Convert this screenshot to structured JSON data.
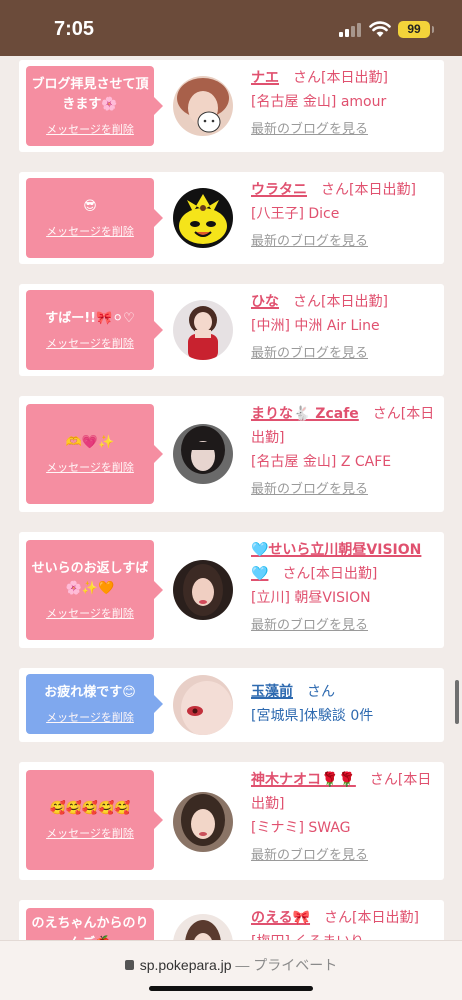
{
  "status_bar": {
    "time": "7:05",
    "battery": "99"
  },
  "browser": {
    "domain": "sp.pokepara.jp",
    "privacy": "— プライベート"
  },
  "common": {
    "delete_label": "メッセージを削除",
    "blog_link": "最新のブログを見る",
    "san": "さん"
  },
  "cards": [
    {
      "bubble_msg": "ブログ拝見させて頂きます🌸",
      "name": "ナエ",
      "status": "[本日出勤]",
      "shop": "[名古屋 金山] amour"
    },
    {
      "bubble_msg": "😎",
      "name": "ウラタニ",
      "status": "[本日出勤]",
      "shop": "[八王子] Dice"
    },
    {
      "bubble_msg": "すばー!!🎀⚪♡",
      "name": "ひな",
      "status": "[本日出勤]",
      "shop": "[中洲] 中洲 Air Line"
    },
    {
      "bubble_msg": "🫶💗✨",
      "name": "まりな🐇 Zcafe",
      "status": "[本日出勤]",
      "shop": "[名古屋 金山] Z CAFE"
    },
    {
      "bubble_msg": "せいらのお返しすば🌸✨🧡",
      "name": "🩵せいら立川朝昼VISION🩵",
      "status": "[本日出勤]",
      "shop": "[立川] 朝昼VISION"
    },
    {
      "bubble_msg": "お疲れ様です😊",
      "name": "玉藻前",
      "status": "",
      "shop": "[宮城県]体験談 0件"
    },
    {
      "bubble_msg": "🥰🥰🥰🥰🥰",
      "name": "神木ナオコ🌹🌹",
      "status": "[本日出勤]",
      "shop": "[ミナミ] SWAG"
    },
    {
      "bubble_msg": "のえちゃんからのりんご🍎",
      "name": "のえる🎀",
      "status": "[本日出勤]",
      "shop": "[梅田] くるまいり"
    }
  ]
}
